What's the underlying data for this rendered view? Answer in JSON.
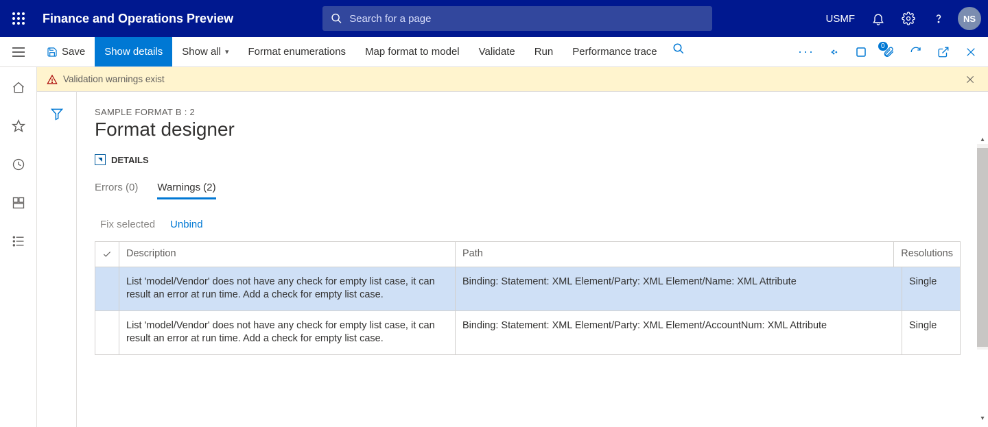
{
  "app_title": "Finance and Operations Preview",
  "search_placeholder": "Search for a page",
  "company": "USMF",
  "avatar_initials": "NS",
  "actionpane": {
    "save": "Save",
    "show_details": "Show details",
    "show_all": "Show all",
    "format_enum": "Format enumerations",
    "map_format": "Map format to model",
    "validate": "Validate",
    "run": "Run",
    "perf_trace": "Performance trace",
    "attachments_badge": "0"
  },
  "messagebar": {
    "text": "Validation warnings exist"
  },
  "page": {
    "breadcrumb": "SAMPLE FORMAT B : 2",
    "title": "Format designer",
    "details_label": "DETAILS"
  },
  "tabs": {
    "errors_label": "Errors (0)",
    "warnings_label": "Warnings (2)"
  },
  "table_actions": {
    "fix_selected": "Fix selected",
    "unbind": "Unbind"
  },
  "grid": {
    "headers": {
      "description": "Description",
      "path": "Path",
      "resolutions": "Resolutions"
    },
    "rows": [
      {
        "description": "List 'model/Vendor' does not have any check for empty list case, it can result an error at run time. Add a check for empty list case.",
        "path": "Binding: Statement: XML Element/Party: XML Element/Name: XML Attribute",
        "resolutions": "Single",
        "selected": true
      },
      {
        "description": "List 'model/Vendor' does not have any check for empty list case, it can result an error at run time. Add a check for empty list case.",
        "path": "Binding: Statement: XML Element/Party: XML Element/AccountNum: XML Attribute",
        "resolutions": "Single",
        "selected": false
      }
    ]
  }
}
